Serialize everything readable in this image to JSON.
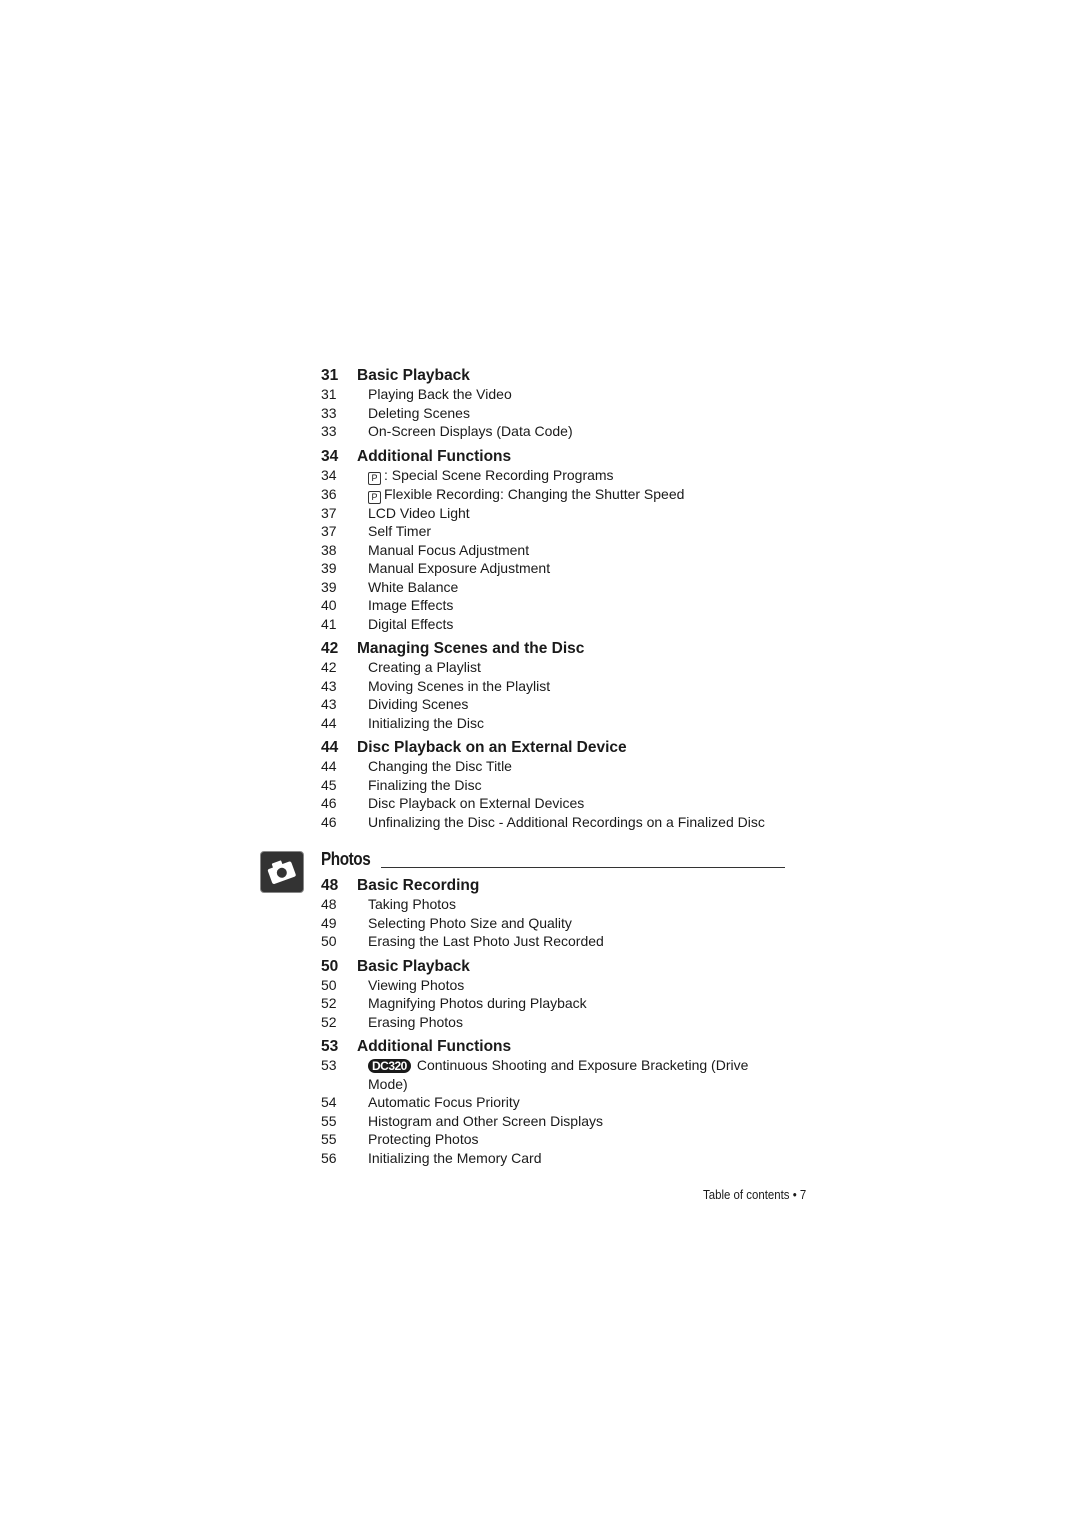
{
  "video_sections": [
    {
      "page": "31",
      "title": "Basic Playback",
      "entries": [
        {
          "page": "31",
          "text": "Playing Back the Video"
        },
        {
          "page": "33",
          "text": "Deleting Scenes"
        },
        {
          "page": "33",
          "text": "On-Screen Displays (Data Code)"
        }
      ]
    },
    {
      "page": "34",
      "title": "Additional Functions",
      "entries": [
        {
          "page": "34",
          "icon": "P",
          "text": ": Special Scene Recording Programs"
        },
        {
          "page": "36",
          "icon": "P",
          "text": "Flexible Recording: Changing the Shutter Speed"
        },
        {
          "page": "37",
          "text": "LCD Video Light"
        },
        {
          "page": "37",
          "text": "Self Timer"
        },
        {
          "page": "38",
          "text": "Manual Focus Adjustment"
        },
        {
          "page": "39",
          "text": "Manual Exposure Adjustment"
        },
        {
          "page": "39",
          "text": "White Balance"
        },
        {
          "page": "40",
          "text": "Image Effects"
        },
        {
          "page": "41",
          "text": "Digital Effects"
        }
      ]
    },
    {
      "page": "42",
      "title": "Managing Scenes and the Disc",
      "entries": [
        {
          "page": "42",
          "text": "Creating a Playlist"
        },
        {
          "page": "43",
          "text": "Moving Scenes in the Playlist"
        },
        {
          "page": "43",
          "text": "Dividing Scenes"
        },
        {
          "page": "44",
          "text": "Initializing the Disc"
        }
      ]
    },
    {
      "page": "44",
      "title": "Disc Playback on an External Device",
      "entries": [
        {
          "page": "44",
          "text": "Changing the Disc Title"
        },
        {
          "page": "45",
          "text": "Finalizing the Disc"
        },
        {
          "page": "46",
          "text": "Disc Playback on External Devices"
        },
        {
          "page": "46",
          "text": "Unfinalizing the Disc - Additional Recordings on a Finalized Disc"
        }
      ]
    }
  ],
  "photos_chapter": {
    "title": "Photos",
    "icon": "camera-icon",
    "sections": [
      {
        "page": "48",
        "title": "Basic Recording",
        "entries": [
          {
            "page": "48",
            "text": "Taking Photos"
          },
          {
            "page": "49",
            "text": "Selecting Photo Size and Quality"
          },
          {
            "page": "50",
            "text": "Erasing the Last Photo Just Recorded"
          }
        ]
      },
      {
        "page": "50",
        "title": "Basic Playback",
        "entries": [
          {
            "page": "50",
            "text": "Viewing Photos"
          },
          {
            "page": "52",
            "text": "Magnifying Photos during Playback"
          },
          {
            "page": "52",
            "text": "Erasing Photos"
          }
        ]
      },
      {
        "page": "53",
        "title": "Additional Functions",
        "entries": [
          {
            "page": "53",
            "badge": "DC320",
            "text": "Continuous Shooting and Exposure Bracketing (Drive Mode)"
          },
          {
            "page": "54",
            "text": "Automatic Focus Priority"
          },
          {
            "page": "55",
            "text": "Histogram and Other Screen Displays"
          },
          {
            "page": "55",
            "text": "Protecting Photos"
          },
          {
            "page": "56",
            "text": "Initializing the Memory Card"
          }
        ]
      }
    ]
  },
  "footer": {
    "label": "Table of contents",
    "separator": "•",
    "page_number": "7"
  }
}
